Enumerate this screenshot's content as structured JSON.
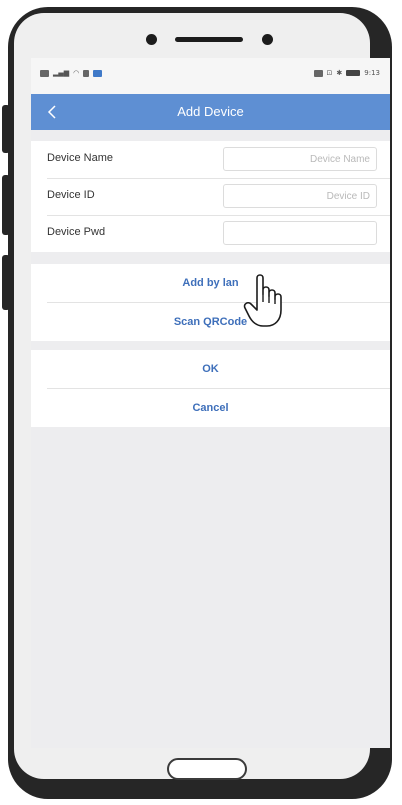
{
  "status_bar": {
    "right_text": "9:13"
  },
  "nav": {
    "title": "Add Device"
  },
  "form": {
    "rows": [
      {
        "label": "Device Name",
        "placeholder": "Device Name"
      },
      {
        "label": "Device ID",
        "placeholder": "Device ID"
      },
      {
        "label": "Device Pwd",
        "placeholder": ""
      }
    ]
  },
  "actions_top": {
    "add_by_lan": "Add by lan",
    "scan_qrcode": "Scan QRCode"
  },
  "actions_bottom": {
    "ok": "OK",
    "cancel": "Cancel"
  },
  "icons": [
    "back-chevron-icon",
    "pointer-hand-icon",
    "signal-icon",
    "wifi-icon",
    "battery-icon"
  ],
  "colors": {
    "nav_bar": "#5e8fd3",
    "button_text": "#3e6fba",
    "background": "#ededef"
  }
}
